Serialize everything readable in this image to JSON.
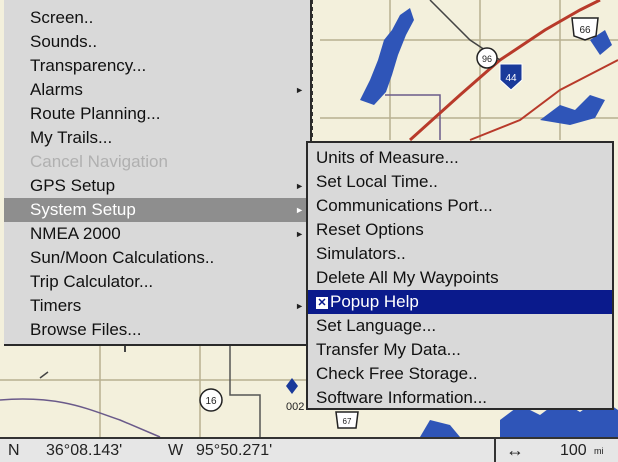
{
  "main_menu": {
    "items": [
      {
        "label": "Screen..",
        "arrow": false,
        "state": "normal"
      },
      {
        "label": "Sounds..",
        "arrow": false,
        "state": "normal"
      },
      {
        "label": "Transparency...",
        "arrow": false,
        "state": "normal"
      },
      {
        "label": "Alarms",
        "arrow": true,
        "state": "normal"
      },
      {
        "label": "Route Planning...",
        "arrow": false,
        "state": "normal"
      },
      {
        "label": "My Trails...",
        "arrow": false,
        "state": "normal"
      },
      {
        "label": "Cancel Navigation",
        "arrow": false,
        "state": "disabled"
      },
      {
        "label": "GPS Setup",
        "arrow": true,
        "state": "normal"
      },
      {
        "label": "System Setup",
        "arrow": true,
        "state": "selected"
      },
      {
        "label": "NMEA 2000",
        "arrow": true,
        "state": "normal"
      },
      {
        "label": "Sun/Moon Calculations..",
        "arrow": false,
        "state": "normal"
      },
      {
        "label": "Trip Calculator...",
        "arrow": false,
        "state": "normal"
      },
      {
        "label": "Timers",
        "arrow": true,
        "state": "normal"
      },
      {
        "label": "Browse Files...",
        "arrow": false,
        "state": "normal"
      }
    ]
  },
  "sub_menu": {
    "items": [
      {
        "label": "Units of Measure...",
        "state": "normal"
      },
      {
        "label": "Set Local Time..",
        "state": "normal"
      },
      {
        "label": "Communications Port...",
        "state": "normal"
      },
      {
        "label": "Reset Options",
        "state": "normal"
      },
      {
        "label": "Simulators..",
        "state": "normal"
      },
      {
        "label": "Delete All My Waypoints",
        "state": "normal"
      },
      {
        "label": "Popup Help",
        "state": "selected",
        "checked": true
      },
      {
        "label": "Set Language...",
        "state": "normal"
      },
      {
        "label": "Transfer My Data...",
        "state": "normal"
      },
      {
        "label": "Check Free Storage..",
        "state": "normal"
      },
      {
        "label": "Software Information...",
        "state": "normal"
      }
    ]
  },
  "map_labels": {
    "route_66": "66",
    "route_96": "96",
    "interstate_44": "44",
    "route_16": "16",
    "waypoint_label": "002",
    "bottom_route": "67"
  },
  "status_bar": {
    "lat_prefix": "N",
    "lat_value": "36°08.143'",
    "lon_prefix": "W",
    "lon_value": "95°50.271'",
    "scale_icon": "↔",
    "scale_value": "100",
    "scale_unit": "mi"
  },
  "colors": {
    "map_bg": "#f3f0dc",
    "water": "#2f55b8",
    "menu_bg": "#d9d9d9",
    "selected_grey": "#8e8e8e",
    "selected_blue": "#0a1a8c"
  }
}
